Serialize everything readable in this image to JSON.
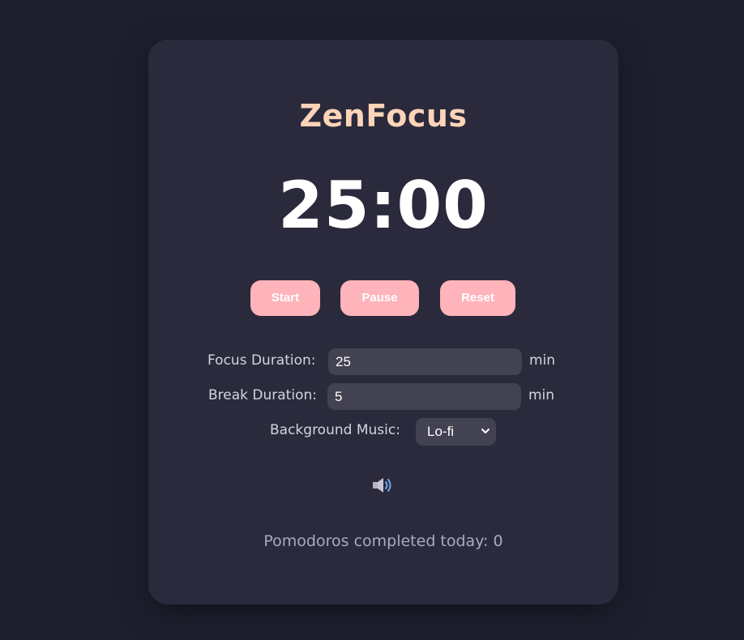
{
  "app": {
    "title": "ZenFocus"
  },
  "timer": {
    "display": "25:00"
  },
  "controls": {
    "start_label": "Start",
    "pause_label": "Pause",
    "reset_label": "Reset"
  },
  "settings": {
    "focus_label": "Focus Duration:",
    "focus_value": "25",
    "focus_unit": "min",
    "break_label": "Break Duration:",
    "break_value": "5",
    "break_unit": "min",
    "music_label": "Background Music:",
    "music_value": "Lo-fi"
  },
  "sound": {
    "icon": "speaker-icon"
  },
  "stats": {
    "pomodoros_text": "Pomodoros completed today: 0"
  },
  "colors": {
    "background": "#1e1e2e",
    "card": "#2a2a3c",
    "accent_title": "#fdd4b8",
    "button": "#ffb3ba",
    "input_bg": "#424253"
  }
}
